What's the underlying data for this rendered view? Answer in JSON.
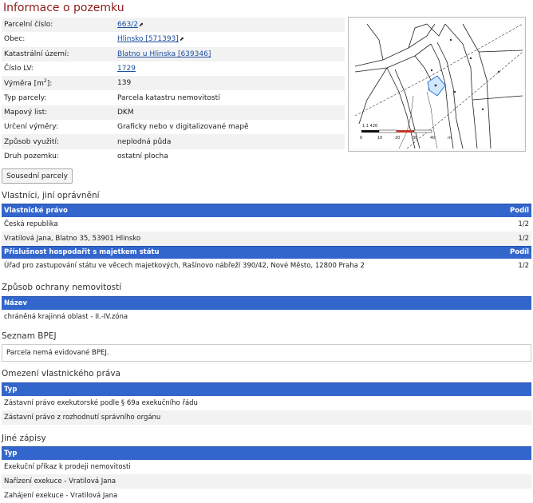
{
  "title": "Informace o pozemku",
  "info": {
    "rows": [
      {
        "label": "Parcelní číslo:",
        "value": "663/2",
        "link": true,
        "ext": true
      },
      {
        "label": "Obec:",
        "value": "Hlinsko [571393]",
        "link": true,
        "ext": true
      },
      {
        "label": "Katastrální území:",
        "value": "Blatno u Hlinska [639346]",
        "link": true,
        "ext": false
      },
      {
        "label": "Číslo LV:",
        "value": "1729",
        "link": true,
        "ext": false
      },
      {
        "label": "Výměra [m²]:",
        "value": "139",
        "link": false,
        "ext": false
      },
      {
        "label": "Typ parcely:",
        "value": "Parcela katastru nemovitostí",
        "link": false,
        "ext": false
      },
      {
        "label": "Mapový list:",
        "value": "DKM",
        "link": false,
        "ext": false
      },
      {
        "label": "Určení výměry:",
        "value": "Graficky nebo v digitalizované mapě",
        "link": false,
        "ext": false
      },
      {
        "label": "Způsob využití:",
        "value": "neplodná půda",
        "link": false,
        "ext": false
      },
      {
        "label": "Druh pozemku:",
        "value": "ostatní plocha",
        "link": false,
        "ext": false
      }
    ]
  },
  "map": {
    "scale_label": "1:1 426",
    "scale_ticks": [
      "0",
      "10",
      "20",
      "30",
      "40",
      "m"
    ],
    "bar_color": "#c0392b"
  },
  "neighbors_button": "Sousední parcely",
  "owners": {
    "title": "Vlastníci, jiní oprávnění",
    "group1": {
      "header": "Vlastnické právo",
      "share_header": "Podíl"
    },
    "rows1": [
      {
        "name": "Česká republika",
        "share": "1/2"
      },
      {
        "name": "Vratilová Jana, Blatno 35, 53901 Hlinsko",
        "share": "1/2"
      }
    ],
    "group2": {
      "header": "Příslušnost hospodařit s majetkem státu",
      "share_header": "Podíl"
    },
    "rows2": [
      {
        "name": "Úřad pro zastupování státu ve věcech majetkových, Rašínovo nábřeží 390/42, Nové Město, 12800 Praha 2",
        "share": "1/2"
      }
    ]
  },
  "protection": {
    "title": "Způsob ochrany nemovitostí",
    "header": "Název",
    "rows": [
      "chráněná krajinná oblast - II.-IV.zóna"
    ]
  },
  "bpej": {
    "title": "Seznam BPEJ",
    "text": "Parcela nemá evidované BPEJ."
  },
  "restrictions": {
    "title": "Omezení vlastnického práva",
    "header": "Typ",
    "rows": [
      "Zástavní právo exekutorské podle § 69a exekučního řádu",
      "Zástavní právo z rozhodnutí správního orgánu"
    ]
  },
  "other": {
    "title": "Jiné zápisy",
    "header": "Typ",
    "rows": [
      "Exekuční příkaz k prodeji nemovitosti",
      "Nařízení exekuce - Vratilová Jana",
      "Zahájení exekuce - Vratilová Jana"
    ]
  }
}
